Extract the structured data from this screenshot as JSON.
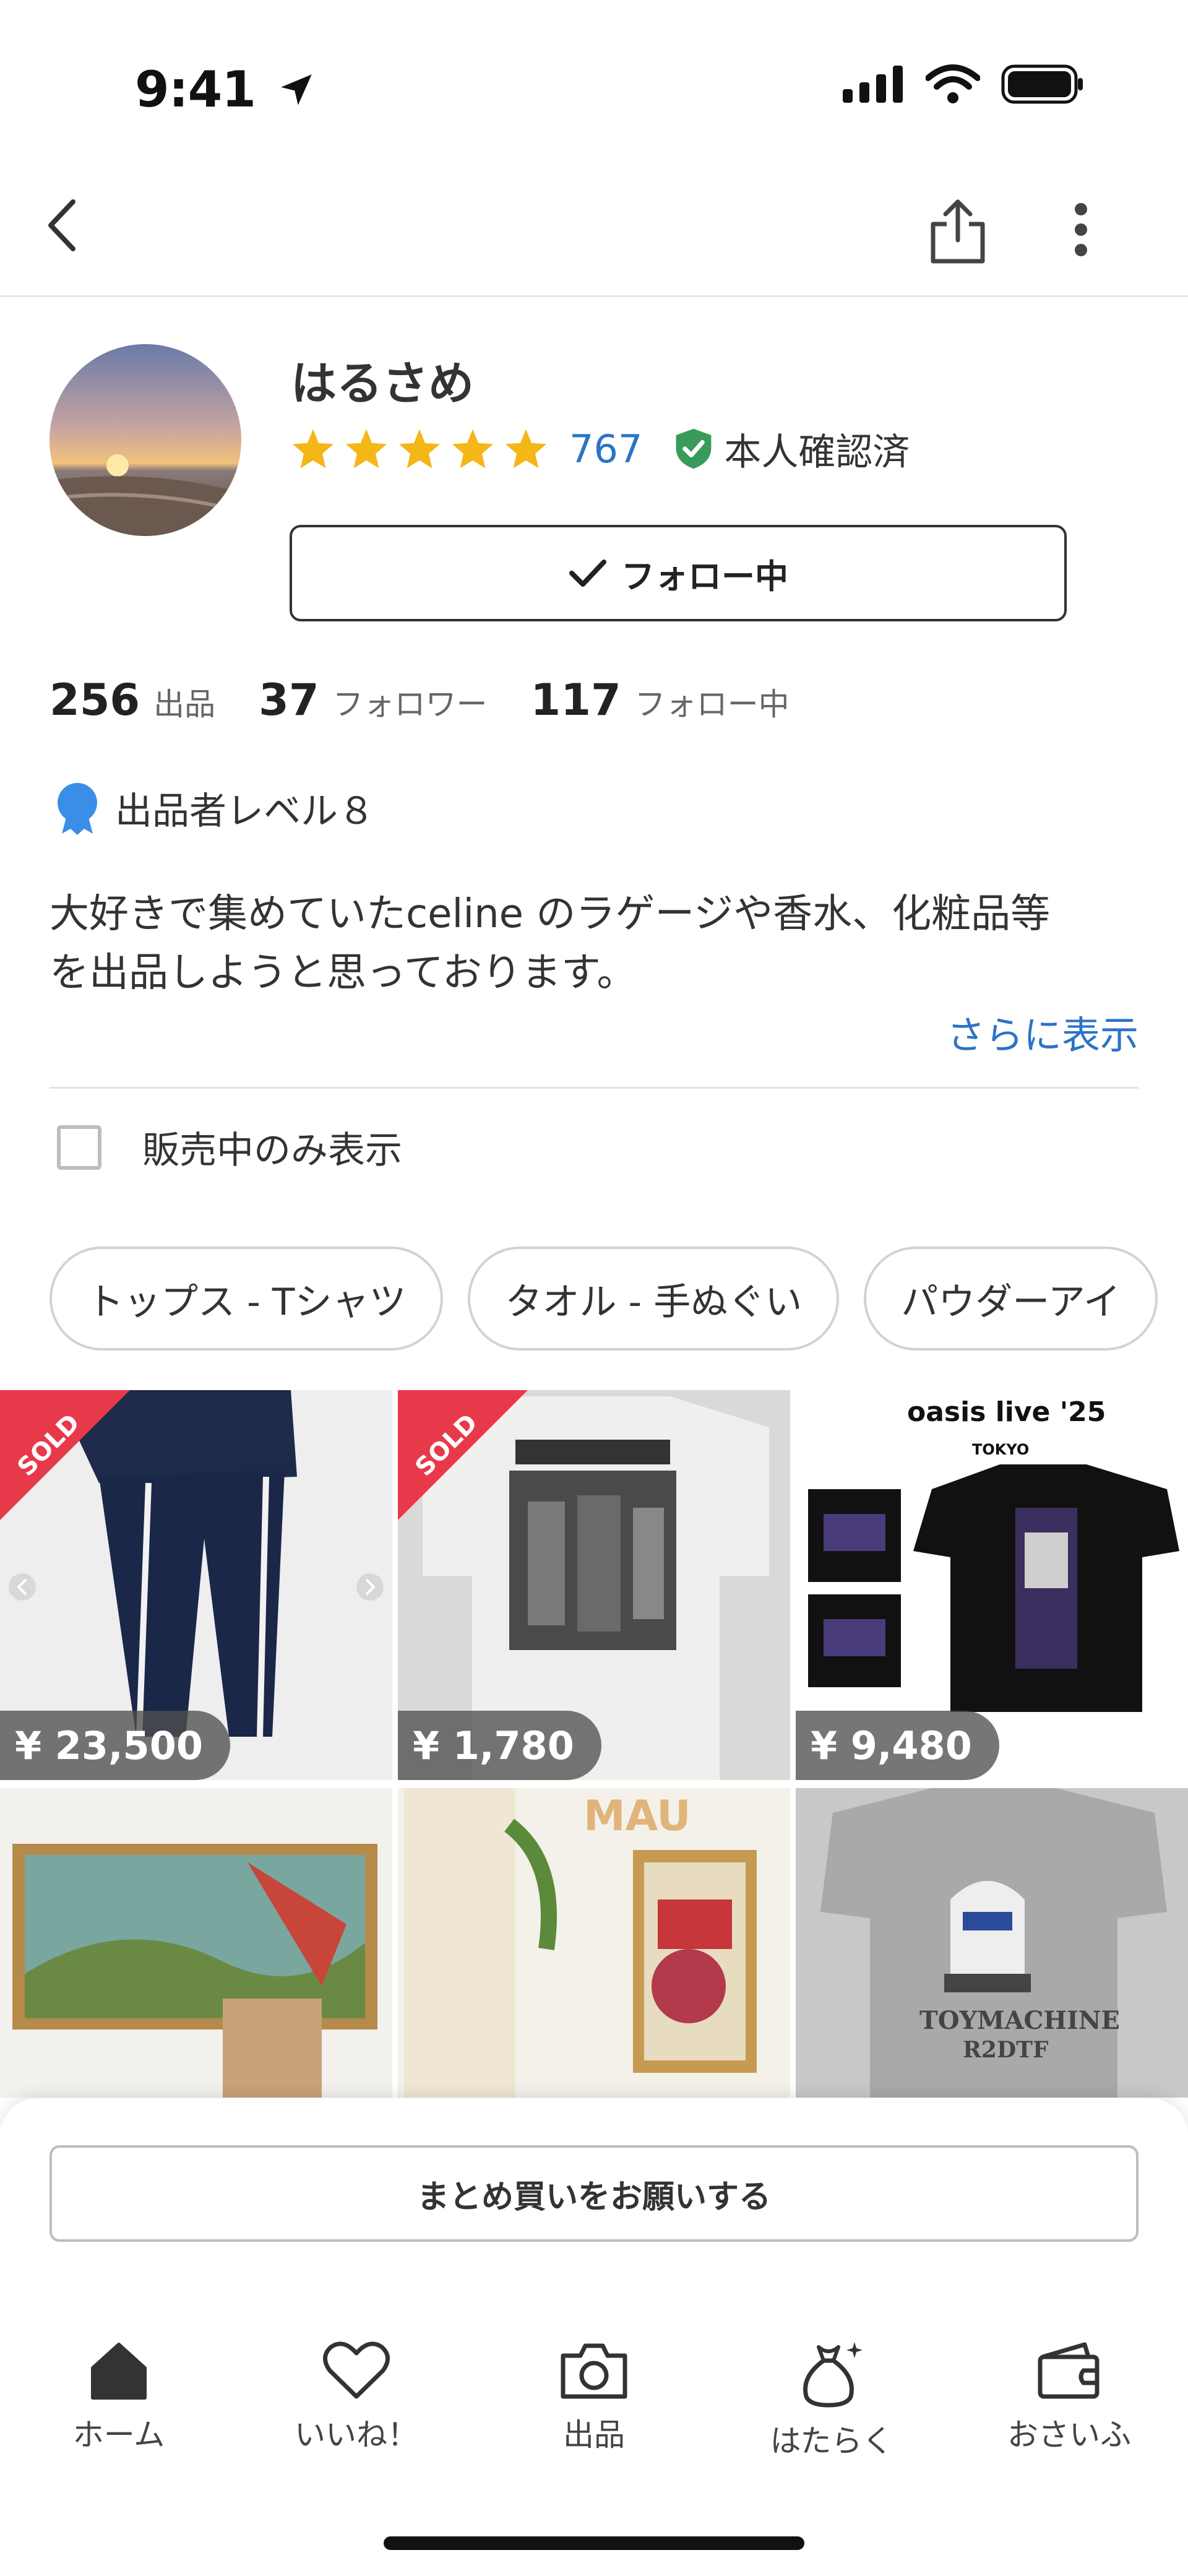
{
  "status_bar": {
    "time": "9:41"
  },
  "profile": {
    "name": "はるさめ",
    "rating_count": "767",
    "verified_label": "本人確認済",
    "follow_label": "フォロー中",
    "stats": [
      {
        "value": "256",
        "label": "出品"
      },
      {
        "value": "37",
        "label": "フォロワー"
      },
      {
        "value": "117",
        "label": "フォロー中"
      }
    ],
    "level_label": "出品者レベル８",
    "bio_line1": "大好きで集めていたceline のラゲージや香水、化粧品等",
    "bio_line2": "を出品しようと思っております。",
    "more_label": "さらに表示"
  },
  "filter": {
    "on_sale_only_label": "販売中のみ表示",
    "on_sale_only_checked": false
  },
  "categories": [
    "トップス - Tシャツ",
    "タオル - 手ぬぐい",
    "パウダーアイ"
  ],
  "items": [
    {
      "price": "¥ 23,500",
      "sold": true,
      "sold_label": "SOLD"
    },
    {
      "price": "¥ 1,780",
      "sold": true,
      "sold_label": "SOLD"
    },
    {
      "price": "¥ 9,480",
      "sold": false,
      "title_text": "oasis live '25",
      "subtitle_text": "TOKYO"
    },
    {
      "price": "",
      "sold": false
    },
    {
      "price": "",
      "sold": false,
      "title_text": "MAU"
    },
    {
      "price": "",
      "sold": false,
      "title_text": "TOYMACHINE",
      "subtitle_text": "R2DTF"
    }
  ],
  "bulk_request_label": "まとめ買いをお願いする",
  "tabs": [
    {
      "label": "ホーム",
      "icon": "home-icon"
    },
    {
      "label": "いいね！",
      "icon": "heart-icon"
    },
    {
      "label": "出品",
      "icon": "camera-icon"
    },
    {
      "label": "はたらく",
      "icon": "money-bag-icon"
    },
    {
      "label": "おさいふ",
      "icon": "wallet-icon"
    }
  ],
  "colors": {
    "accent_blue": "#2b74c7",
    "star": "#f5b617",
    "verified_green": "#3a9a5a",
    "sold_red": "#e8394a"
  }
}
